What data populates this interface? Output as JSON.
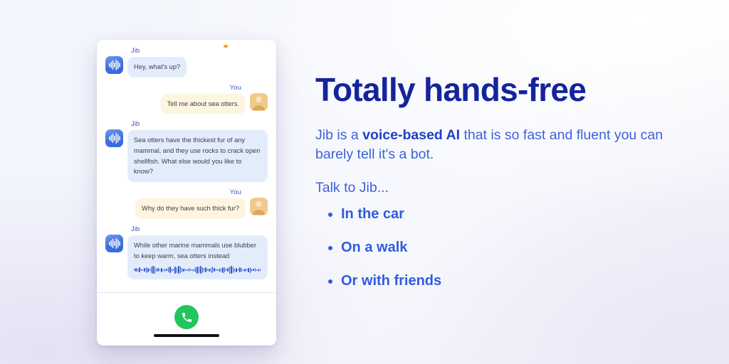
{
  "phone": {
    "mic_indicator": "microphone-active",
    "messages": [
      {
        "speaker": "Jib",
        "side": "left",
        "avatar": "jib-waveform-avatar",
        "text": "Hey, what's up?",
        "waveform": false
      },
      {
        "speaker": "You",
        "side": "right",
        "avatar": "user-person-avatar",
        "text": "Tell me about sea otters.",
        "waveform": false
      },
      {
        "speaker": "Jib",
        "side": "left",
        "avatar": "jib-waveform-avatar",
        "text": "Sea otters have the thickest fur of any mammal, and they use rocks to crack open shellfish. What else would you like to know?",
        "waveform": false
      },
      {
        "speaker": "You",
        "side": "right",
        "avatar": "user-person-avatar",
        "text": "Why do they have such thick fur?",
        "waveform": false
      },
      {
        "speaker": "Jib",
        "side": "left",
        "avatar": "jib-waveform-avatar",
        "text": "While other marine mammals use blubber to keep warm, sea otters instead",
        "waveform": true
      }
    ],
    "call_button": {
      "icon": "phone-icon",
      "label": "Call",
      "color": "#22c55e"
    },
    "home_indicator": "home-indicator-bar"
  },
  "copy": {
    "headline": "Totally hands-free",
    "lede_before": "Jib is a ",
    "lede_strong": "voice-based AI",
    "lede_after": " that is so fast and fluent you can barely tell it's a bot.",
    "talk_label": "Talk to Jib...",
    "bullets": [
      {
        "label": "In the car"
      },
      {
        "label": "On a walk"
      },
      {
        "label": "Or with friends"
      }
    ]
  },
  "colors": {
    "headline": "#15249c",
    "body_blue": "#3c62d8",
    "bullet_blue": "#2f5ce0",
    "jib_bubble": "#e3ecfb",
    "you_bubble": "#fdf5e0",
    "call_green": "#22c55e",
    "mic_orange": "#f5a623",
    "jib_avatar": "#3f6fe0",
    "you_avatar": "#f3c98a"
  },
  "waveform_heights": [
    3,
    5,
    4,
    7,
    3,
    2,
    5,
    8,
    6,
    3,
    9,
    11,
    10,
    4,
    5,
    3,
    6,
    2,
    4,
    3,
    7,
    9,
    4,
    3,
    10,
    8,
    11,
    9,
    6,
    4,
    3,
    2,
    5,
    3,
    2,
    4,
    7,
    10,
    9,
    11,
    8,
    5,
    7,
    3,
    4,
    6,
    9,
    5,
    3,
    2,
    6,
    4,
    8,
    7,
    3,
    5,
    10,
    11,
    9,
    4,
    6,
    3,
    7,
    5,
    2,
    4,
    3,
    6,
    8,
    4,
    3,
    5,
    2,
    4,
    3
  ]
}
